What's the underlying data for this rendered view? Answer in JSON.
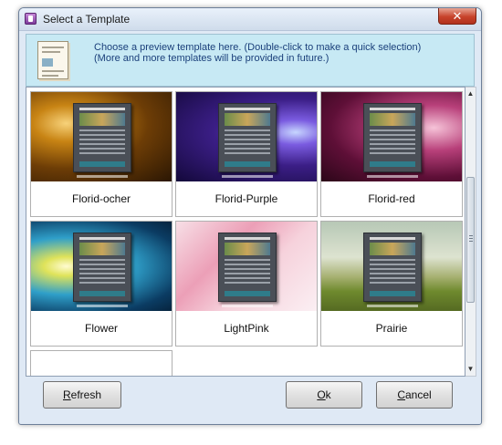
{
  "window": {
    "title": "Select a Template",
    "close_glyph": "✕"
  },
  "info": {
    "line1": "Choose a preview template here. (Double-click to make a quick selection)",
    "line2": "(More and more templates will be provided in future.)",
    "icon": "template-document-icon"
  },
  "templates": [
    {
      "label": "Florid-ocher",
      "bg": "radial-gradient(ellipse at 25% 35%, #f7d27a 0%, #c88414 22%, #6d3d06 55%, #2a1603 100%)"
    },
    {
      "label": "Florid-Purple",
      "bg": "radial-gradient(ellipse at 85% 45%, #c7d6ff 0%, #7a5be0 18%, #3b1e86 48%, #13083a 100%)"
    },
    {
      "label": "Florid-red",
      "bg": "radial-gradient(ellipse at 80% 40%, #f6c3d8 0%, #b8407a 30%, #5e0f37 65%, #2b0618 100%)"
    },
    {
      "label": "Flower",
      "bg": "radial-gradient(ellipse at 25% 50%, #fffbd0 0%, #dfe35a 15%, #2f9fc9 45%, #0b3c63 80%, #06243e 100%)"
    },
    {
      "label": "LightPink",
      "bg": "linear-gradient(135deg, #f7dfe6 0%, #ec9fb7 35%, #f6d2dc 60%, #fbeff3 100%)"
    },
    {
      "label": "Prairie",
      "bg": "linear-gradient(180deg, #b7c8b6 0%, #dde3d0 40%, #a6b071 62%, #6f8a2e 78%, #556a22 100%)"
    },
    {
      "label": "",
      "bg": "#ffffff"
    }
  ],
  "buttons": {
    "refresh": {
      "key": "R",
      "rest": "efresh"
    },
    "ok": {
      "key": "O",
      "rest": "k"
    },
    "cancel": {
      "key": "C",
      "rest": "ancel"
    }
  },
  "scrollbar": {
    "up_glyph": "▲",
    "down_glyph": "▼"
  }
}
